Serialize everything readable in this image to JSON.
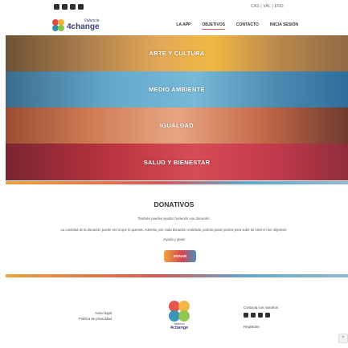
{
  "header": {
    "social_icons": [
      "instagram-icon",
      "facebook-icon",
      "twitter-icon",
      "email-icon"
    ],
    "language_switch": "CAS | VAL | ENG"
  },
  "nav": {
    "logo": {
      "small": "Valencia",
      "main": "4change"
    },
    "items": [
      {
        "label": "LA APP",
        "active": false
      },
      {
        "label": "OBJETIVOS",
        "active": true
      },
      {
        "label": "CONTACTO",
        "active": false
      },
      {
        "label": "INICIA SESIÓN",
        "active": false
      }
    ]
  },
  "banners": [
    {
      "label": "ARTE Y CULTURA",
      "color": "#e2a857"
    },
    {
      "label": "MEDIO AMBIENTE",
      "color": "#63a8cb"
    },
    {
      "label": "IGUALDAD",
      "color": "#cf7c55"
    },
    {
      "label": "SALUD Y BIENESTAR",
      "color": "#b8343f"
    }
  ],
  "donativos": {
    "title": "DONATIVOS",
    "text1": "También puedes ayudar haciendo una donación.",
    "text2": "La cantidad de la donación puede ser la que tú quieras. Además, por cada donación realizada, podrás ganar puntos para subir de nivel en tus objetivos.",
    "text3": "¡Ayuda y gana!",
    "button": "DONAR"
  },
  "footer": {
    "links": [
      "Aviso legal",
      "Política de privacidad"
    ],
    "logo": {
      "small": "Valencia",
      "main": "4change"
    },
    "contact_label": "Contacta con nosotros",
    "social_icons": [
      "instagram-icon",
      "facebook-icon",
      "twitter-icon",
      "email-icon"
    ],
    "register": "Regístrate",
    "back_to_top": "^"
  }
}
